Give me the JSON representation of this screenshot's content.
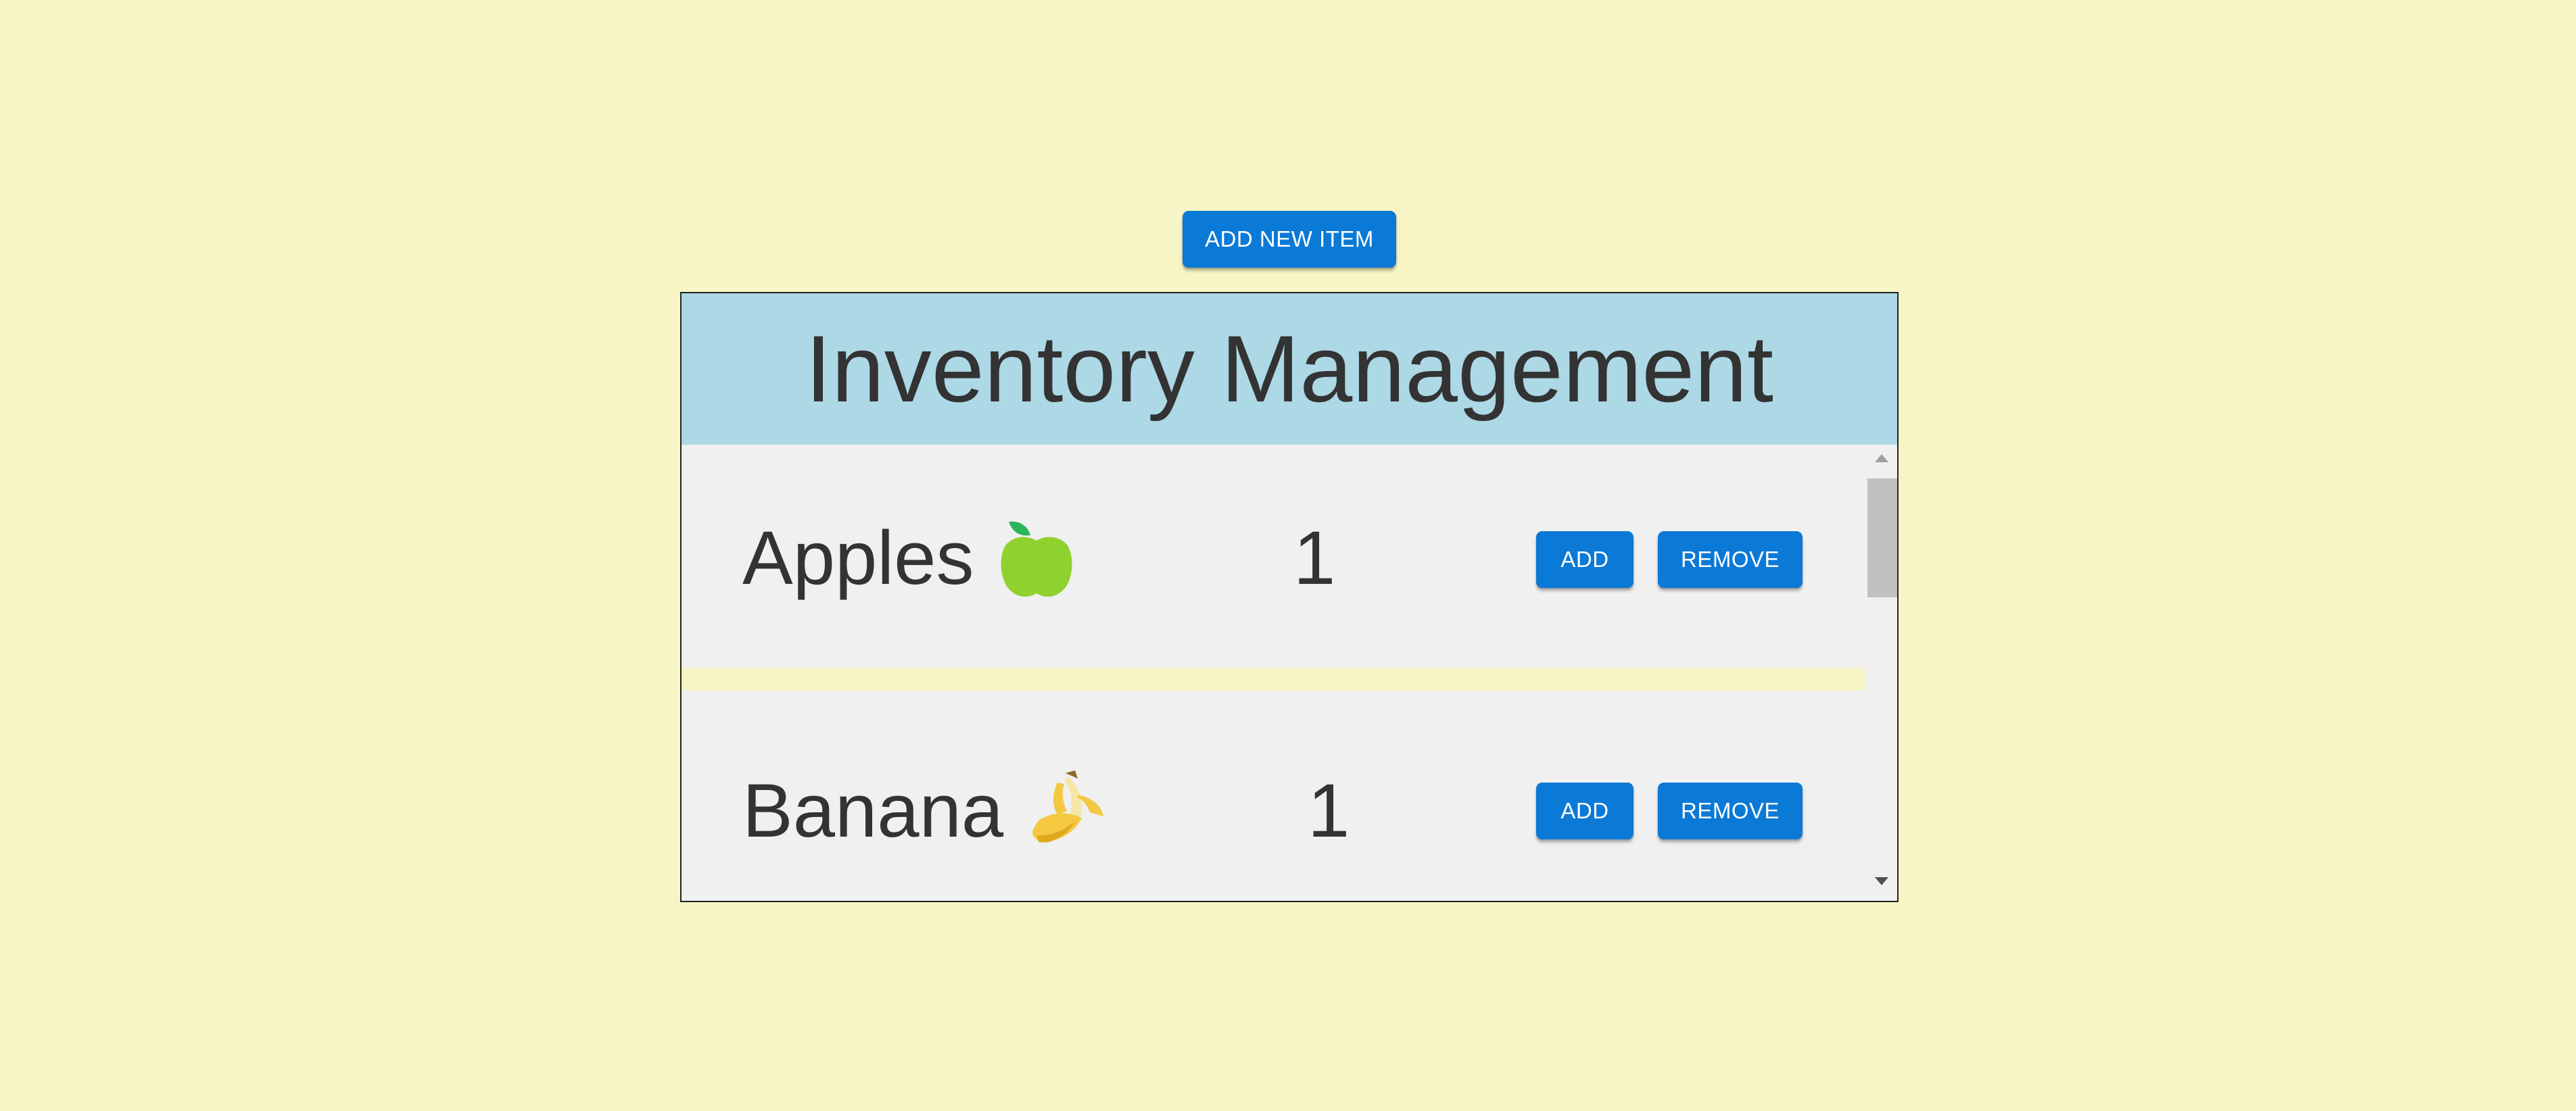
{
  "toolbar": {
    "add_new_label": "ADD NEW ITEM"
  },
  "panel": {
    "title": "Inventory Management",
    "header_color": "#add8e6"
  },
  "items": [
    {
      "name": "Apples",
      "icon": "green-apple-icon",
      "quantity": "1",
      "add_label": "ADD",
      "remove_label": "REMOVE"
    },
    {
      "name": "Banana",
      "icon": "banana-icon",
      "quantity": "1",
      "add_label": "ADD",
      "remove_label": "REMOVE"
    }
  ],
  "colors": {
    "background": "#f7f5c5",
    "button": "#0b79d6",
    "row": "#f0f0f0",
    "text": "#333333"
  }
}
